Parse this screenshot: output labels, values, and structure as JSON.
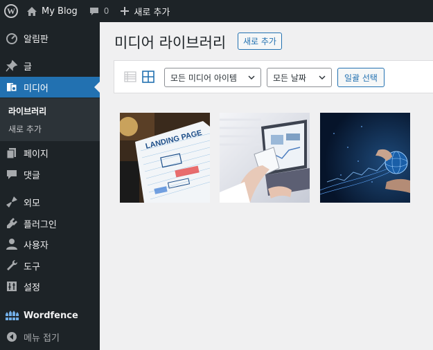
{
  "adminbar": {
    "site_name": "My Blog",
    "comment_count": "0",
    "new_label": "새로 추가"
  },
  "sidebar": {
    "items": [
      {
        "label": "알림판",
        "icon": "dashboard-icon"
      },
      {
        "label": "글",
        "icon": "pin-icon"
      },
      {
        "label": "미디어",
        "icon": "media-icon"
      },
      {
        "label": "페이지",
        "icon": "pages-icon"
      },
      {
        "label": "댓글",
        "icon": "comments-icon"
      },
      {
        "label": "외모",
        "icon": "appearance-icon"
      },
      {
        "label": "플러그인",
        "icon": "plugins-icon"
      },
      {
        "label": "사용자",
        "icon": "users-icon"
      },
      {
        "label": "도구",
        "icon": "tools-icon"
      },
      {
        "label": "설정",
        "icon": "settings-icon"
      },
      {
        "label": "Wordfence",
        "icon": "wordfence-icon"
      }
    ],
    "submenu": [
      "라이브러리",
      "새로 추가"
    ],
    "collapse_label": "메뉴 접기"
  },
  "main": {
    "title": "미디어 라이브러리",
    "add_new": "새로 추가",
    "filter_type": "모든 미디어 아이템",
    "filter_date": "모든 날짜",
    "bulk_select": "일괄 선택",
    "thumb1_text": "LANDING PAGE"
  },
  "colors": {
    "accent": "#2271b1",
    "admin_bg": "#1d2327"
  }
}
